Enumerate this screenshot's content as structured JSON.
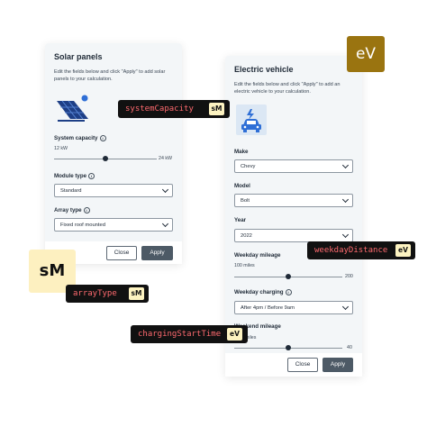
{
  "solar": {
    "title": "Solar panels",
    "description": "Edit the fields below and click \"Apply\" to add solar panels to your calculation.",
    "icon": "solar-panel-icon",
    "capacity_label": "System capacity",
    "capacity_value": "12 kW",
    "capacity_max": "24 kW",
    "capacity_fraction": 0.5,
    "module_label": "Module type",
    "module_value": "Standard",
    "array_label": "Array type",
    "array_value": "Fixed roof mounted",
    "close_label": "Close",
    "apply_label": "Apply"
  },
  "ev": {
    "title": "Electric vehicle",
    "description": "Edit the fields below and click \"Apply\" to add an electric vehicle to your calculation.",
    "icon": "electric-car-icon",
    "make_label": "Make",
    "make_value": "Chevy",
    "model_label": "Model",
    "model_value": "Bolt",
    "year_label": "Year",
    "year_value": "2022",
    "weekday_label": "Weekday mileage",
    "weekday_value": "100 miles",
    "weekday_max": "200",
    "weekday_fraction": 0.5,
    "charging_label": "Weekday charging",
    "charging_value": "After 4pm / Before 9am",
    "weekend_label": "Weekend mileage",
    "weekend_value": "miles",
    "weekend_max": "40",
    "weekend_fraction": 0.5,
    "close_label": "Close",
    "apply_label": "Apply"
  },
  "tags": {
    "system_capacity": {
      "name": "systemCapacity",
      "badge": "sM"
    },
    "array_type": {
      "name": "arrayType",
      "badge": "sM"
    },
    "weekday_distance": {
      "name": "weekdayDistance",
      "badge": "eV"
    },
    "charging_start_time": {
      "name": "chargingStartTime",
      "badge": "eV"
    }
  },
  "badges": {
    "ev": "eV",
    "sm": "sM"
  },
  "colors": {
    "ev_badge": "#9a7410",
    "sm_badge": "#fdf0c0",
    "tag_text": "#ff6a6f",
    "apply_button": "#4d5a66"
  }
}
